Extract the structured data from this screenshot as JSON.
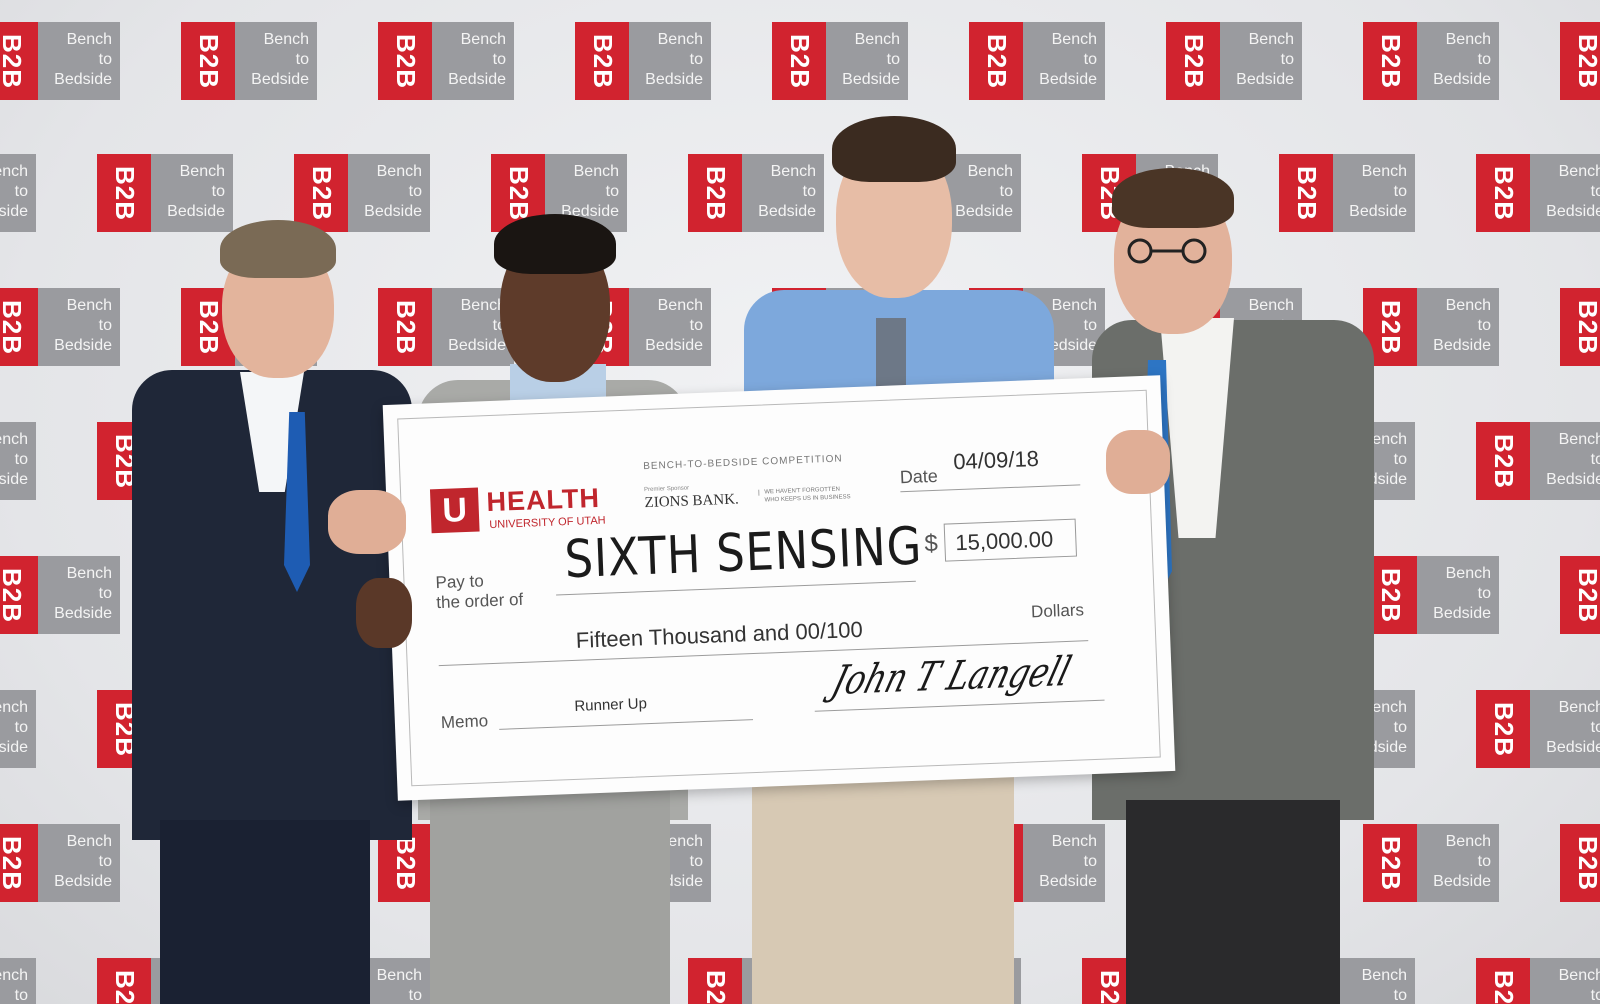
{
  "backdrop": {
    "logo_mark": "B2B",
    "logo_line1": "Bench",
    "logo_line2": "to",
    "logo_line3": "Bedside",
    "colors": {
      "red": "#d1232f",
      "grey": "#9a9b9f"
    }
  },
  "check": {
    "competition": "BENCH-TO-BEDSIDE COMPETITION",
    "sponsor_caption": "Premier Sponsor",
    "sponsor": "ZIONS BANK.",
    "sponsor_tagline_1": "WE HAVEN'T FORGOTTEN",
    "sponsor_tagline_2": "WHO KEEPS US IN BUSINESS",
    "org_name": "HEALTH",
    "org_sub": "UNIVERSITY OF UTAH",
    "org_mark": "U",
    "date_label": "Date",
    "date": "04/09/18",
    "payto_label_1": "Pay to",
    "payto_label_2": "the order of",
    "payee": "SIXTH SENSING",
    "currency": "$",
    "amount": "15,000.00",
    "amount_words": "Fifteen Thousand and 00/100",
    "dollars_label": "Dollars",
    "memo_label": "Memo",
    "memo": "Runner Up",
    "signature": "John T Langell",
    "colors": {
      "brand": "#c0262d"
    }
  }
}
